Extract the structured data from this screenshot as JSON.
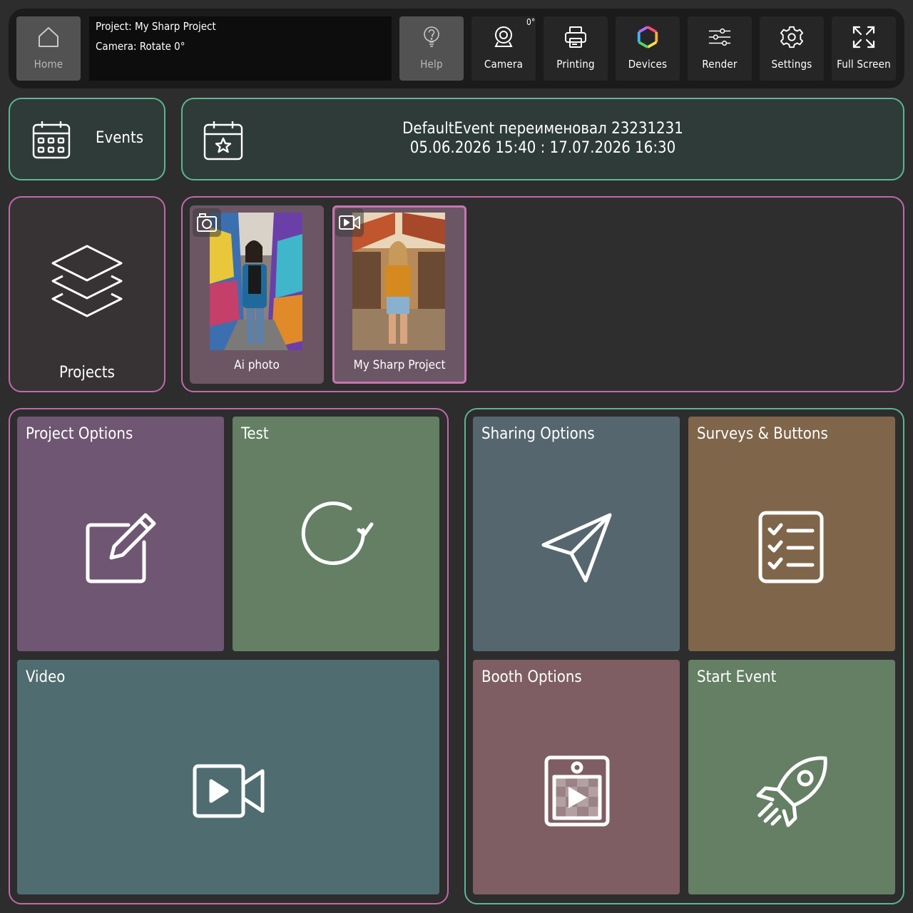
{
  "topbar": {
    "home_label": "Home",
    "project_line": "Project: My Sharp Project",
    "camera_line": "Camera: Rotate 0°",
    "help_label": "Help",
    "camera_label": "Camera",
    "camera_rotation_badge": "0°",
    "printing_label": "Printing",
    "devices_label": "Devices",
    "render_label": "Render",
    "settings_label": "Settings",
    "fullscreen_label": "Full Screen"
  },
  "events": {
    "button_label": "Events",
    "current_title": "DefaultEvent переименовал 23231231",
    "current_dates": "05.06.2026 15:40 : 17.07.2026 16:30"
  },
  "projects": {
    "button_label": "Projects",
    "items": [
      {
        "name": "Ai photo",
        "type_icon": "camera-icon",
        "selected": false
      },
      {
        "name": "My Sharp Project",
        "type_icon": "video-camera-icon",
        "selected": true
      }
    ]
  },
  "tiles": {
    "project_options": {
      "label": "Project Options",
      "color": "#6f5672",
      "icon": "edit-icon"
    },
    "test": {
      "label": "Test",
      "color": "#647f64",
      "icon": "refresh-icon"
    },
    "video": {
      "label": "Video",
      "color": "#4f6c70",
      "icon": "video-icon"
    },
    "sharing_options": {
      "label": "Sharing Options",
      "color": "#56666e",
      "icon": "send-icon"
    },
    "surveys_buttons": {
      "label": "Surveys & Buttons",
      "color": "#7f654a",
      "icon": "checklist-icon"
    },
    "booth_options": {
      "label": "Booth Options",
      "color": "#7e5e62",
      "icon": "booth-icon"
    },
    "start_event": {
      "label": "Start Event",
      "color": "#647f64",
      "icon": "rocket-icon"
    }
  },
  "colors": {
    "background": "#2d2d2d",
    "accent_green": "#5db592",
    "accent_pink": "#c06aa9"
  }
}
